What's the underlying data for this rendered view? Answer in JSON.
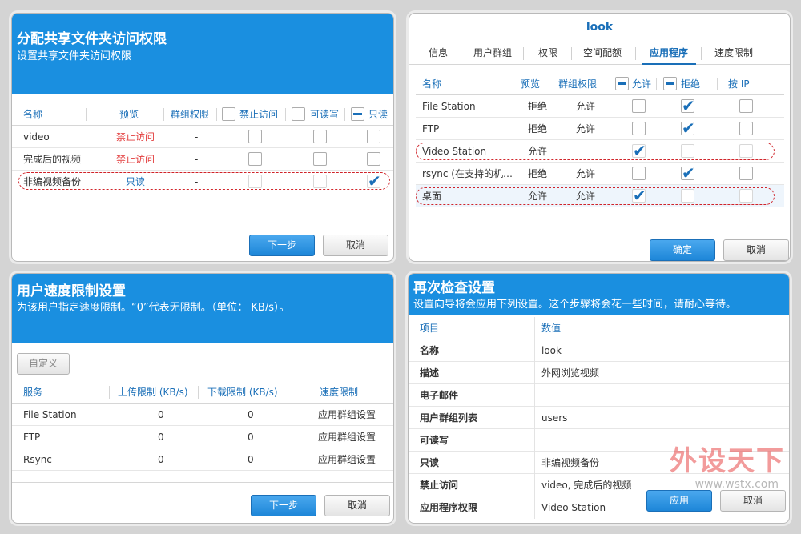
{
  "p1": {
    "title": "分配共享文件夹访问权限",
    "subtitle": "设置共享文件夹访问权限",
    "columns": {
      "name": "名称",
      "preview": "预览",
      "group": "群组权限",
      "deny": "禁止访问",
      "rw": "可读写",
      "ro": "只读"
    },
    "rows": [
      {
        "name": "video",
        "preview": "禁止访问",
        "group": "-"
      },
      {
        "name": "完成后的视频",
        "preview": "禁止访问",
        "group": "-"
      },
      {
        "name": "非编视频备份",
        "preview": "只读",
        "group": "-"
      }
    ],
    "next_label": "下一步",
    "cancel_label": "取消"
  },
  "p2": {
    "title": "look",
    "tabs": [
      "信息",
      "用户群组",
      "权限",
      "空间配额",
      "应用程序",
      "速度限制"
    ],
    "active_tab": "应用程序",
    "columns": {
      "name": "名称",
      "preview": "预览",
      "group": "群组权限",
      "allow": "允许",
      "deny": "拒绝",
      "ip": "按 IP"
    },
    "rows": [
      {
        "name": "File Station",
        "preview": "拒绝",
        "group": "允许"
      },
      {
        "name": "FTP",
        "preview": "拒绝",
        "group": "允许"
      },
      {
        "name": "Video Station",
        "preview": "允许",
        "group": ""
      },
      {
        "name": "rsync (在支持的机…",
        "preview": "拒绝",
        "group": "允许"
      },
      {
        "name": "桌面",
        "preview": "允许",
        "group": "允许"
      }
    ],
    "ok_label": "确定",
    "cancel_label": "取消"
  },
  "p3": {
    "title": "用户速度限制设置",
    "subtitle": "为该用户指定速度限制。“0”代表无限制。（单位： KB/s）。",
    "custom_label": "自定义",
    "columns": {
      "service": "服务",
      "upload": "上传限制 (KB/s)",
      "download": "下载限制 (KB/s)",
      "limit": "速度限制"
    },
    "rows": [
      {
        "service": "File Station",
        "upload": "0",
        "download": "0",
        "limit": "应用群组设置"
      },
      {
        "service": "FTP",
        "upload": "0",
        "download": "0",
        "limit": "应用群组设置"
      },
      {
        "service": "Rsync",
        "upload": "0",
        "download": "0",
        "limit": "应用群组设置"
      }
    ],
    "next_label": "下一步",
    "cancel_label": "取消"
  },
  "p4": {
    "title": "再次检查设置",
    "subtitle": "设置向导将会应用下列设置。这个步骤将会花一些时间，请耐心等待。",
    "columns": {
      "item": "项目",
      "value": "数值"
    },
    "rows": [
      {
        "item": "名称",
        "value": "look"
      },
      {
        "item": "描述",
        "value": "外网浏览视频"
      },
      {
        "item": "电子邮件",
        "value": ""
      },
      {
        "item": "用户群组列表",
        "value": "users"
      },
      {
        "item": "可读写",
        "value": ""
      },
      {
        "item": "只读",
        "value": "非编视频备份"
      },
      {
        "item": "禁止访问",
        "value": "video, 完成后的视频"
      },
      {
        "item": "应用程序权限",
        "value": "Video Station"
      }
    ],
    "apply_label": "应用",
    "cancel_label": "取消"
  },
  "watermark": {
    "text": "外设天下",
    "url": "www.wstx.com"
  }
}
